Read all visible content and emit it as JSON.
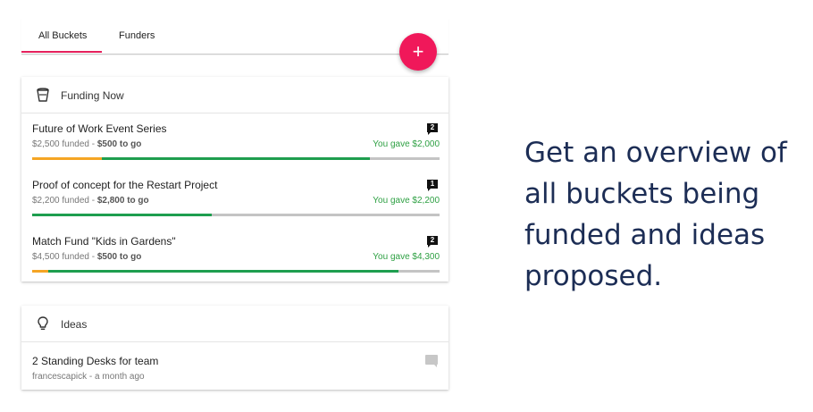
{
  "tabs": [
    {
      "label": "All Buckets",
      "active": true
    },
    {
      "label": "Funders",
      "active": false
    }
  ],
  "fab": {
    "label": "+"
  },
  "funding_now": {
    "title": "Funding Now",
    "icon": "bucket-icon",
    "items": [
      {
        "title": "Future of Work Event Series",
        "funded": "$2,500 funded",
        "separator": " - ",
        "remaining": "$500 to go",
        "gave": "You gave $2,000",
        "comments": "2",
        "progress": {
          "orange": 0.17,
          "green": 0.83
        }
      },
      {
        "title": "Proof of concept for the Restart Project",
        "funded": "$2,200 funded",
        "separator": " - ",
        "remaining": "$2,800 to go",
        "gave": "You gave $2,200",
        "comments": "1",
        "progress": {
          "orange": 0.0,
          "green": 0.44
        }
      },
      {
        "title": "Match Fund \"Kids in Gardens\"",
        "funded": "$4,500 funded",
        "separator": " - ",
        "remaining": "$500 to go",
        "gave": "You gave $4,300",
        "comments": "2",
        "progress": {
          "orange": 0.04,
          "green": 0.9
        }
      }
    ]
  },
  "ideas": {
    "title": "Ideas",
    "icon": "lightbulb-icon",
    "items": [
      {
        "title": "2 Standing Desks for team",
        "meta": "francescapick - a month ago",
        "icon": "comment-icon"
      }
    ]
  },
  "caption": [
    "Get an overview of",
    "all buckets being",
    "funded and ideas",
    "proposed."
  ],
  "colors": {
    "accent": "#e5215c",
    "fab": "#f0185a",
    "progress_green": "#1e9e4f",
    "progress_orange": "#f5a524",
    "gave_text": "#2ea043",
    "caption": "#1c2d55"
  }
}
